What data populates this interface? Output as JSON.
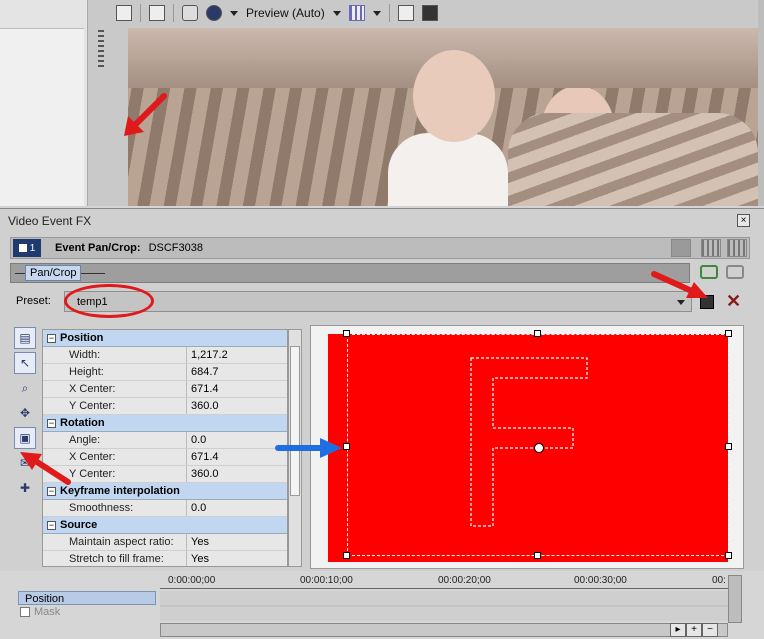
{
  "toolbar": {
    "preview_mode": "Preview (Auto)"
  },
  "dialog": {
    "title": "Video Event FX",
    "close_glyph": "×",
    "event_number": "1",
    "event_label": "Event Pan/Crop:",
    "event_file": "DSCF3038",
    "chain_tab": "Pan/Crop",
    "preset_label": "Preset:",
    "preset_value": "temp1",
    "delete_glyph": "✕"
  },
  "properties": {
    "position": {
      "title": "Position",
      "rows": [
        {
          "key": "Width:",
          "value": "1,217.2"
        },
        {
          "key": "Height:",
          "value": "684.7"
        },
        {
          "key": "X Center:",
          "value": "671.4"
        },
        {
          "key": "Y Center:",
          "value": "360.0"
        }
      ]
    },
    "rotation": {
      "title": "Rotation",
      "rows": [
        {
          "key": "Angle:",
          "value": "0.0"
        },
        {
          "key": "X Center:",
          "value": "671.4"
        },
        {
          "key": "Y Center:",
          "value": "360.0"
        }
      ]
    },
    "keyframe": {
      "title": "Keyframe interpolation",
      "rows": [
        {
          "key": "Smoothness:",
          "value": "0.0"
        }
      ]
    },
    "source": {
      "title": "Source",
      "rows": [
        {
          "key": "Maintain aspect ratio:",
          "value": "Yes"
        },
        {
          "key": "Stretch to fill frame:",
          "value": "Yes"
        }
      ]
    }
  },
  "timeline": {
    "tracks": [
      "Position",
      "Mask"
    ],
    "ticks": [
      "0:00:00;00",
      "00:00:10;00",
      "00:00:20;00",
      "00:00:30;00",
      "00:"
    ]
  },
  "colors": {
    "crop_fill": "#ff0000",
    "annotation_red": "#e0191b",
    "annotation_blue": "#1f6fe0",
    "category_bg": "#c0d6f1"
  }
}
